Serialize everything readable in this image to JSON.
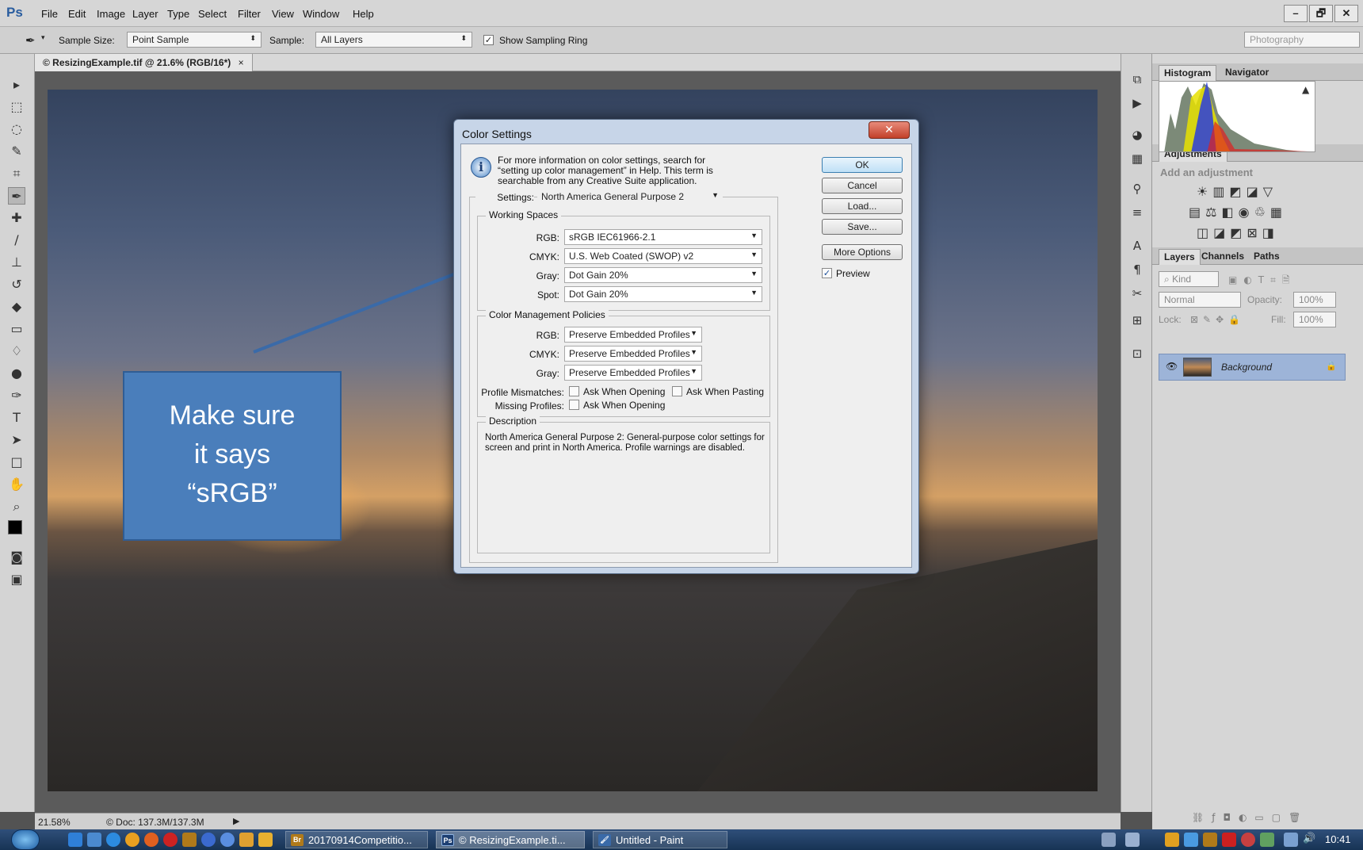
{
  "app": {
    "logo": "Ps",
    "accent": "#2a5d9f"
  },
  "menu": [
    "File",
    "Edit",
    "Image",
    "Layer",
    "Type",
    "Select",
    "Filter",
    "View",
    "Window",
    "Help"
  ],
  "window_controls": {
    "minimize": "–",
    "restore": "🗗",
    "close": "✕"
  },
  "options_bar": {
    "sample_size_label": "Sample Size:",
    "sample_size_value": "Point Sample",
    "sample_label": "Sample:",
    "sample_value": "All Layers",
    "show_ring_checked": true,
    "show_ring_label": "Show Sampling Ring",
    "workspace": "Photography"
  },
  "document": {
    "tab_title": "© ResizingExample.tif @ 21.6% (RGB/16*)",
    "tab_close": "×",
    "zoom": "21.58%",
    "doc_info": "© Doc: 137.3M/137.3M"
  },
  "panels": {
    "histogram_tabs": [
      "Histogram",
      "Navigator"
    ],
    "adjustments_tab": "Adjustments",
    "adjustments_hint": "Add an adjustment",
    "layers_tabs": [
      "Layers",
      "Channels",
      "Paths"
    ],
    "kind_label": "Kind",
    "blend_mode": "Normal",
    "opacity_label": "Opacity:",
    "opacity_value": "100%",
    "lock_label": "Lock:",
    "fill_label": "Fill:",
    "fill_value": "100%",
    "layer_name": "Background"
  },
  "dialog": {
    "title": "Color Settings",
    "close": "✕",
    "info_text": "For more information on color settings, search for “setting up color management” in Help. This term is searchable from any Creative Suite application.",
    "buttons": {
      "ok": "OK",
      "cancel": "Cancel",
      "load": "Load...",
      "save": "Save...",
      "more_options": "More Options"
    },
    "preview_label": "Preview",
    "preview_checked": true,
    "settings_label": "Settings:",
    "settings_value": "North America General Purpose 2",
    "working_spaces": {
      "title": "Working Spaces",
      "rgb_label": "RGB:",
      "rgb_value": "sRGB IEC61966-2.1",
      "cmyk_label": "CMYK:",
      "cmyk_value": "U.S. Web Coated (SWOP) v2",
      "gray_label": "Gray:",
      "gray_value": "Dot Gain 20%",
      "spot_label": "Spot:",
      "spot_value": "Dot Gain 20%"
    },
    "policies": {
      "title": "Color Management Policies",
      "rgb_label": "RGB:",
      "rgb_value": "Preserve Embedded Profiles",
      "cmyk_label": "CMYK:",
      "cmyk_value": "Preserve Embedded Profiles",
      "gray_label": "Gray:",
      "gray_value": "Preserve Embedded Profiles",
      "mismatch_label": "Profile Mismatches:",
      "ask_opening": "Ask When Opening",
      "ask_pasting": "Ask When Pasting",
      "missing_label": "Missing Profiles:",
      "ask_opening_missing": "Ask When Opening"
    },
    "description": {
      "title": "Description",
      "text": "North America General Purpose 2:  General-purpose color settings for screen and print in North America. Profile warnings are disabled."
    }
  },
  "callout": {
    "lines": [
      "Make sure",
      "it says",
      "“sRGB”"
    ],
    "color": "#4a7ebb"
  },
  "taskbar": {
    "tasks": [
      {
        "badge": "Br",
        "label": "20170914Competitio...",
        "color": "#b07a1a"
      },
      {
        "badge": "Ps",
        "label": "© ResizingExample.ti...",
        "color": "#1d3f72"
      },
      {
        "badge": "🖌",
        "label": "Untitled - Paint",
        "color": "#3a6aa8"
      }
    ],
    "clock": "10:41"
  }
}
